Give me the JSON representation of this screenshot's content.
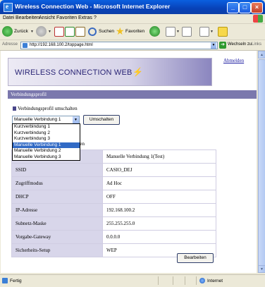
{
  "window": {
    "title": "Wireless Connection Web - Microsoft Internet Explorer"
  },
  "menu": {
    "items": [
      "Datei",
      "Bearbeiten",
      "Ansicht",
      "Favoriten",
      "Extras",
      "?"
    ]
  },
  "toolbar": {
    "back": "Zurück",
    "search": "Suchen",
    "favorites": "Favoriten"
  },
  "address": {
    "label": "Adresse",
    "url": "http://192.168.100.2/toppage.html",
    "go": "Wechseln zu",
    "links": "Links"
  },
  "page": {
    "banner_title": "WIRELESS CONNECTION WEB",
    "logout": "Abmelden",
    "section_title": "Verbindungsprofil",
    "switch_label": "Verbindungsprofil umschalten",
    "selected_profile": "Manuelle Verbindung 1",
    "switch_button": "Umschalten",
    "profile_options": [
      "Kurzverbindung 1",
      "Kurzverbindung 2",
      "Kurzverbindung 3",
      "Manuelle Verbindung 1",
      "Manuelle Verbindung 2",
      "Manuelle Verbindung 3"
    ],
    "subheading": "llungen",
    "settings": [
      {
        "key": "",
        "value": "Manuelle Verbindung 1(Test)"
      },
      {
        "key": "SSID",
        "value": "CASIO_DEJ"
      },
      {
        "key": "Zugriffmodus",
        "value": "Ad Hoc"
      },
      {
        "key": "DHCP",
        "value": "OFF"
      },
      {
        "key": "IP-Adresse",
        "value": "192.168.100.2"
      },
      {
        "key": "Subnetz-Maske",
        "value": "255.255.255.0"
      },
      {
        "key": "Vorgabe-Gateway",
        "value": "0.0.0.0"
      },
      {
        "key": "Sicherheits-Setup",
        "value": "WEP"
      }
    ],
    "edit_button": "Bearbeiten"
  },
  "status": {
    "text": "Fertig",
    "zone": "Internet"
  }
}
